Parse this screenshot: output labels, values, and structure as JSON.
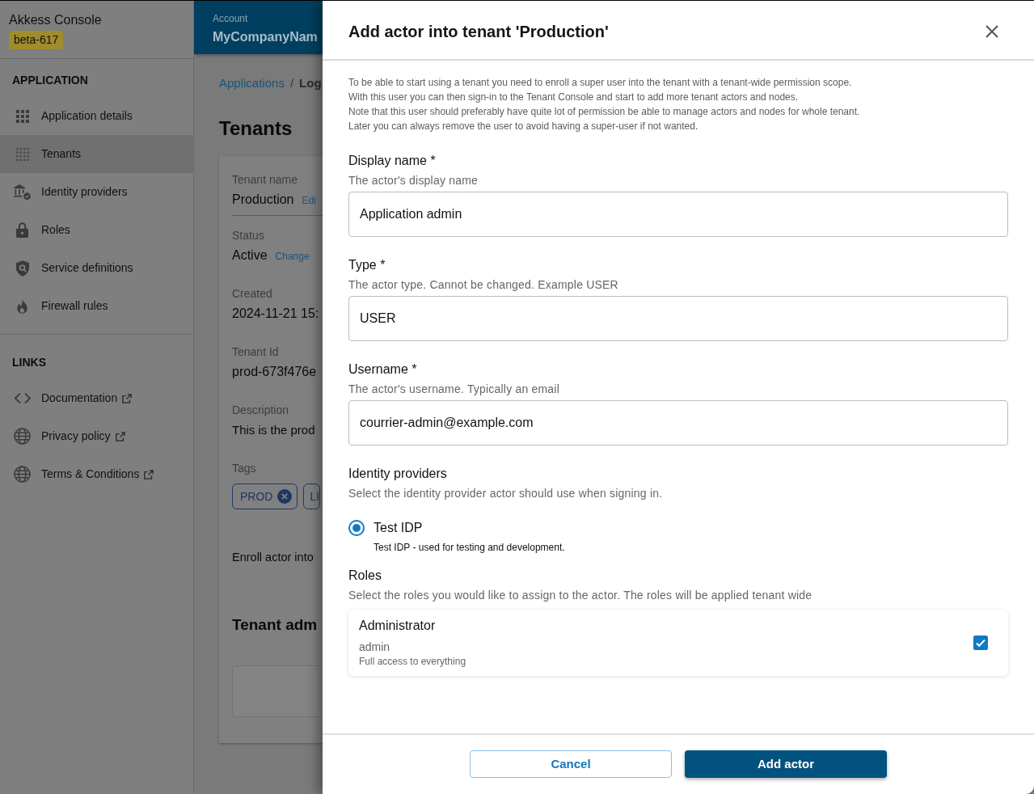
{
  "sidebar": {
    "app_name": "Akkess Console",
    "version_badge": "beta-617",
    "application_section": {
      "heading": "APPLICATION",
      "items": [
        {
          "label": "Application details",
          "selected": false
        },
        {
          "label": "Tenants",
          "selected": true
        },
        {
          "label": "Identity providers",
          "selected": false
        },
        {
          "label": "Roles",
          "selected": false
        },
        {
          "label": "Service definitions",
          "selected": false
        },
        {
          "label": "Firewall rules",
          "selected": false
        }
      ]
    },
    "links_section": {
      "heading": "LINKS",
      "items": [
        {
          "label": "Documentation"
        },
        {
          "label": "Privacy policy"
        },
        {
          "label": "Terms & Conditions"
        }
      ]
    }
  },
  "top_bar": {
    "account_label": "Account",
    "account_name": "MyCompanyNam"
  },
  "breadcrumb": {
    "parent": "Applications",
    "separator": "/",
    "current": "Log"
  },
  "page_title": "Tenants",
  "tenant_card": {
    "fields": [
      {
        "label": "Tenant name",
        "value": "Production",
        "action": "Edi"
      },
      {
        "label": "Status",
        "value": "Active",
        "action": "Change"
      },
      {
        "label": "Created",
        "value": "2024-11-21 15:"
      },
      {
        "label": "Tenant Id",
        "value": "prod-673f476e"
      },
      {
        "label": "Description",
        "value": "This is the prod"
      }
    ],
    "tags_label": "Tags",
    "tags": [
      {
        "label": "PROD",
        "removable": true
      },
      {
        "label": "LI",
        "removable": false
      }
    ],
    "enroll_text": "Enroll actor into",
    "admins_heading": "Tenant adm"
  },
  "modal": {
    "title": "Add actor into tenant 'Production'",
    "intro_lines": [
      "To be able to start using a tenant you need to enroll a super user into the tenant with a tenant-wide permission scope.",
      "With this user you can then sign-in to the Tenant Console and start to add more tenant actors and nodes.",
      "Note that this user should preferably have quite lot of permission be able to manage actors and nodes for whole tenant.",
      "Later you can always remove the user to avoid having a super-user if not wanted."
    ],
    "fields": [
      {
        "label": "Display name *",
        "hint": "The actor's display name",
        "value": "Application admin"
      },
      {
        "label": "Type *",
        "hint": "The actor type. Cannot be changed. Example USER",
        "value": "USER"
      },
      {
        "label": "Username *",
        "hint": "The actor's username. Typically an email",
        "value": "courrier-admin@example.com"
      }
    ],
    "identity_providers": {
      "label": "Identity providers",
      "hint": "Select the identity provider actor should use when signing in.",
      "options": [
        {
          "label": "Test IDP",
          "description": "Test IDP - used for testing and development.",
          "selected": true
        }
      ]
    },
    "roles": {
      "label": "Roles",
      "hint": "Select the roles you would like to assign to the actor. The roles will be applied tenant wide",
      "items": [
        {
          "name": "Administrator",
          "code": "admin",
          "description": "Full access to everything",
          "checked": true
        }
      ]
    },
    "buttons": [
      {
        "label": "Cancel",
        "kind": "secondary"
      },
      {
        "label": "Add actor",
        "kind": "primary"
      }
    ]
  }
}
